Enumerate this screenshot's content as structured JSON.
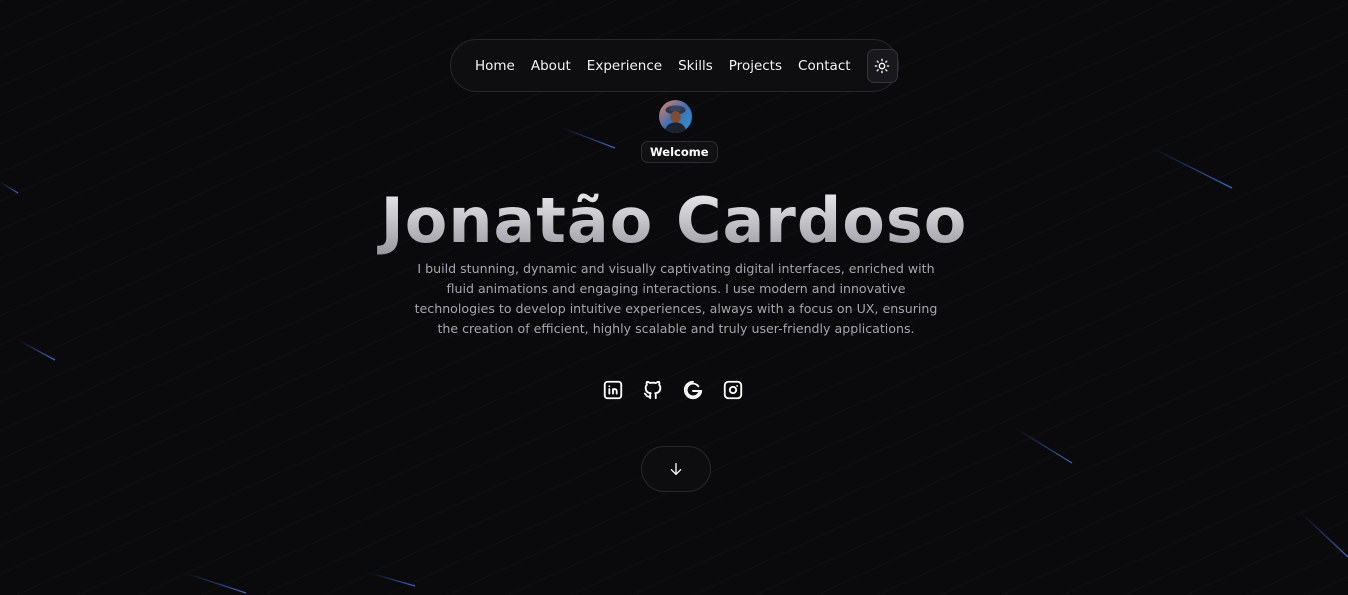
{
  "nav": {
    "links": [
      {
        "label": "Home"
      },
      {
        "label": "About"
      },
      {
        "label": "Experience"
      },
      {
        "label": "Skills"
      },
      {
        "label": "Projects"
      },
      {
        "label": "Contact"
      }
    ],
    "theme_toggle_icon": "sun-icon"
  },
  "hero": {
    "badge": "Welcome",
    "title": "Jonatão Cardoso",
    "description": "I build stunning, dynamic and visually captivating digital interfaces, enriched with fluid animations and engaging interactions. I use modern and innovative technologies to develop intuitive experiences, always with a focus on UX, ensuring the creation of efficient, highly scalable and truly user-friendly applications."
  },
  "socials": [
    {
      "icon": "linkedin-icon"
    },
    {
      "icon": "github-icon"
    },
    {
      "icon": "google-icon"
    },
    {
      "icon": "instagram-icon"
    }
  ],
  "scroll_icon": "arrow-down-icon",
  "colors": {
    "background": "#0a0a0c",
    "text": "#ffffff",
    "muted_text": "#a5a5ad",
    "border": "#26262b",
    "streak": "#3a63c4"
  }
}
